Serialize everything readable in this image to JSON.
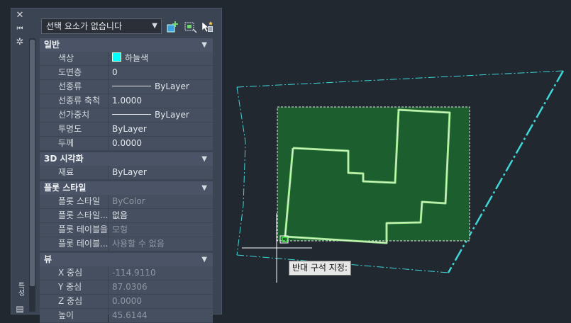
{
  "palette": {
    "selection_dropdown": "선택 요소가 없습니다",
    "side_label": "특성",
    "categories": [
      {
        "title": "일반",
        "rows": [
          {
            "key": "색상",
            "value": "하늘색",
            "kind": "color"
          },
          {
            "key": "도면층",
            "value": "0"
          },
          {
            "key": "선종류",
            "value": "ByLayer",
            "kind": "line"
          },
          {
            "key": "선종류 축척",
            "value": "1.0000"
          },
          {
            "key": "선가중치",
            "value": "ByLayer",
            "kind": "line"
          },
          {
            "key": "투명도",
            "value": "ByLayer"
          },
          {
            "key": "두께",
            "value": "0.0000"
          }
        ]
      },
      {
        "title": "3D 시각화",
        "rows": [
          {
            "key": "재료",
            "value": "ByLayer"
          }
        ]
      },
      {
        "title": "플롯 스타일",
        "rows": [
          {
            "key": "플롯 스타일",
            "value": "ByColor",
            "dim": true
          },
          {
            "key": "플롯 스타일...",
            "value": "없음"
          },
          {
            "key": "플롯 테이블을...",
            "value": "모형",
            "dim": true
          },
          {
            "key": "플롯 테이블...",
            "value": "사용할 수 없음",
            "dim": true
          }
        ]
      },
      {
        "title": "뷰",
        "rows": [
          {
            "key": "X 중심",
            "value": "-114.9110",
            "dim": true
          },
          {
            "key": "Y 중심",
            "value": "87.0306",
            "dim": true
          },
          {
            "key": "Z 중심",
            "value": "0.0000",
            "dim": true
          },
          {
            "key": "높이",
            "value": "45.6144",
            "dim": true
          }
        ]
      }
    ]
  },
  "drawing": {
    "tooltip": "반대 구석 지정:"
  },
  "colors": {
    "background": "#212830",
    "boundary": "#3fd6d6",
    "selection_fill": "#1d5e2f",
    "building_outline": "#7fe07a"
  }
}
